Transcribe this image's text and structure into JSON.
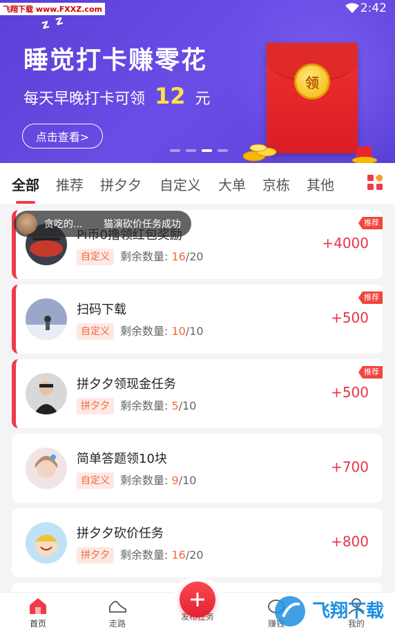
{
  "watermark_top": "飞翔下载 www.FXXZ.com",
  "status": {
    "time": "2:42"
  },
  "banner": {
    "zz": "z z",
    "title": "睡觉打卡赚零花",
    "sub_prefix": "每天早晚打卡可领",
    "sub_amount": "12",
    "sub_suffix": "元",
    "button": "点击查看>",
    "coin_text": "领"
  },
  "tabs": [
    "全部",
    "推荐",
    "拼夕夕",
    "自定义",
    "大单",
    "京栋",
    "其他"
  ],
  "toast": {
    "name": "贪吃的...",
    "message": "猫演砍价任务成功"
  },
  "tasks": [
    {
      "title": "Pi币0撸领红包奖励",
      "tag": "自定义",
      "remain_label": "剩余数量:",
      "remain_current": "16",
      "remain_total": "/20",
      "reward": "+4000",
      "badge": "推荐"
    },
    {
      "title": "扫码下载",
      "tag": "自定义",
      "remain_label": "剩余数量:",
      "remain_current": "10",
      "remain_total": "/10",
      "reward": "+500",
      "badge": "推荐"
    },
    {
      "title": "拼夕夕领现金任务",
      "tag": "拼夕夕",
      "remain_label": "剩余数量:",
      "remain_current": "5",
      "remain_total": "/10",
      "reward": "+500",
      "badge": "推荐"
    },
    {
      "title": "简单答题领10块",
      "tag": "自定义",
      "remain_label": "剩余数量:",
      "remain_current": "9",
      "remain_total": "/10",
      "reward": "+700",
      "badge": ""
    },
    {
      "title": "拼夕夕砍价任务",
      "tag": "拼夕夕",
      "remain_label": "剩余数量:",
      "remain_current": "16",
      "remain_total": "/20",
      "reward": "+800",
      "badge": ""
    }
  ],
  "nav": {
    "home": "首页",
    "walk": "走路",
    "publish": "发布任务",
    "earn": "赚钱",
    "me": "我的"
  },
  "watermark_bottom": "飞翔下载",
  "colors": {
    "accent": "#f03a4a",
    "banner": "#5b3fd6",
    "tag_text": "#f26b3a",
    "reward": "#e8344a"
  }
}
